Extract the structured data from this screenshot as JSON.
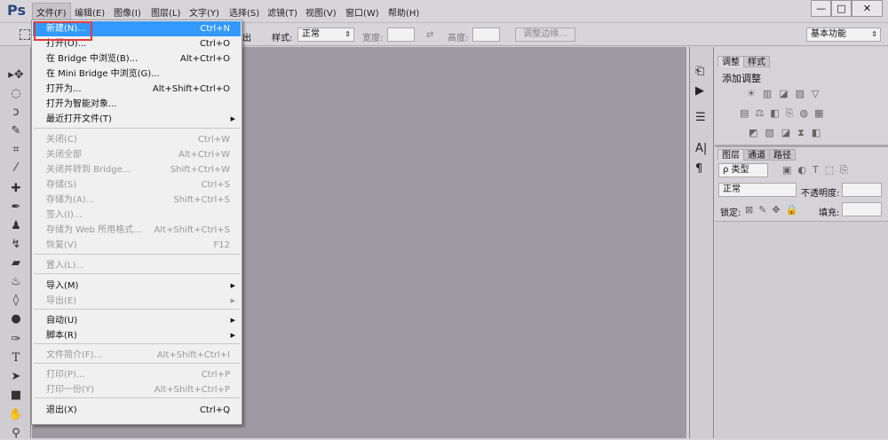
{
  "app": {
    "logo": "Ps",
    "window_controls": [
      "—",
      "□",
      "✕"
    ]
  },
  "menubar": [
    "文件(F)",
    "编辑(E)",
    "图像(I)",
    "图层(L)",
    "文字(Y)",
    "选择(S)",
    "滤镜(T)",
    "视图(V)",
    "窗口(W)",
    "帮助(H)"
  ],
  "options": {
    "partial_text": "出",
    "style_label": "样式:",
    "style_value": "正常",
    "width_label": "宽度:",
    "height_label": "高度:",
    "refine_edge": "调整边缘...",
    "workspace": "基本功能"
  },
  "file_menu": [
    {
      "label": "新建(N)...",
      "shortcut": "Ctrl+N",
      "enabled": true,
      "highlighted": true
    },
    {
      "label": "打开(O)...",
      "shortcut": "Ctrl+O",
      "enabled": true
    },
    {
      "label": "在 Bridge 中浏览(B)...",
      "shortcut": "Alt+Ctrl+O",
      "enabled": true
    },
    {
      "label": "在 Mini Bridge 中浏览(G)...",
      "shortcut": "",
      "enabled": true
    },
    {
      "label": "打开为...",
      "shortcut": "Alt+Shift+Ctrl+O",
      "enabled": true
    },
    {
      "label": "打开为智能对象...",
      "shortcut": "",
      "enabled": true
    },
    {
      "label": "最近打开文件(T)",
      "shortcut": "",
      "enabled": true,
      "submenu": true
    },
    {
      "label": "关闭(C)",
      "shortcut": "Ctrl+W",
      "enabled": false
    },
    {
      "label": "关闭全部",
      "shortcut": "Alt+Ctrl+W",
      "enabled": false
    },
    {
      "label": "关闭并转到 Bridge...",
      "shortcut": "Shift+Ctrl+W",
      "enabled": false
    },
    {
      "label": "存储(S)",
      "shortcut": "Ctrl+S",
      "enabled": false
    },
    {
      "label": "存储为(A)...",
      "shortcut": "Shift+Ctrl+S",
      "enabled": false
    },
    {
      "label": "签入(I)...",
      "shortcut": "",
      "enabled": false
    },
    {
      "label": "存储为 Web 所用格式...",
      "shortcut": "Alt+Shift+Ctrl+S",
      "enabled": false
    },
    {
      "label": "恢复(V)",
      "shortcut": "F12",
      "enabled": false
    },
    {
      "label": "置入(L)...",
      "shortcut": "",
      "enabled": false
    },
    {
      "label": "导入(M)",
      "shortcut": "",
      "enabled": true,
      "submenu": true
    },
    {
      "label": "导出(E)",
      "shortcut": "",
      "enabled": false,
      "submenu": true
    },
    {
      "label": "自动(U)",
      "shortcut": "",
      "enabled": true,
      "submenu": true
    },
    {
      "label": "脚本(R)",
      "shortcut": "",
      "enabled": true,
      "submenu": true
    },
    {
      "label": "文件简介(F)...",
      "shortcut": "Alt+Shift+Ctrl+I",
      "enabled": false
    },
    {
      "label": "打印(P)...",
      "shortcut": "Ctrl+P",
      "enabled": false
    },
    {
      "label": "打印一份(Y)",
      "shortcut": "Alt+Shift+Ctrl+P",
      "enabled": false
    },
    {
      "label": "退出(X)",
      "shortcut": "Ctrl+Q",
      "enabled": true
    }
  ],
  "adjust_panel": {
    "tabs": [
      "调整",
      "样式"
    ],
    "title": "添加调整"
  },
  "layers_panel": {
    "tabs": [
      "图层",
      "通道",
      "路径"
    ],
    "filter": "ρ 类型",
    "blend": "正常",
    "opacity_label": "不透明度:",
    "lock_label": "锁定:",
    "fill_label": "填充:"
  },
  "dock": {
    "char_icon": "A|",
    "para_icon": "¶"
  },
  "colors": {
    "highlight": "#3399ff",
    "annotation_box": "#e53b3b",
    "canvas": "#9c9aa0"
  }
}
